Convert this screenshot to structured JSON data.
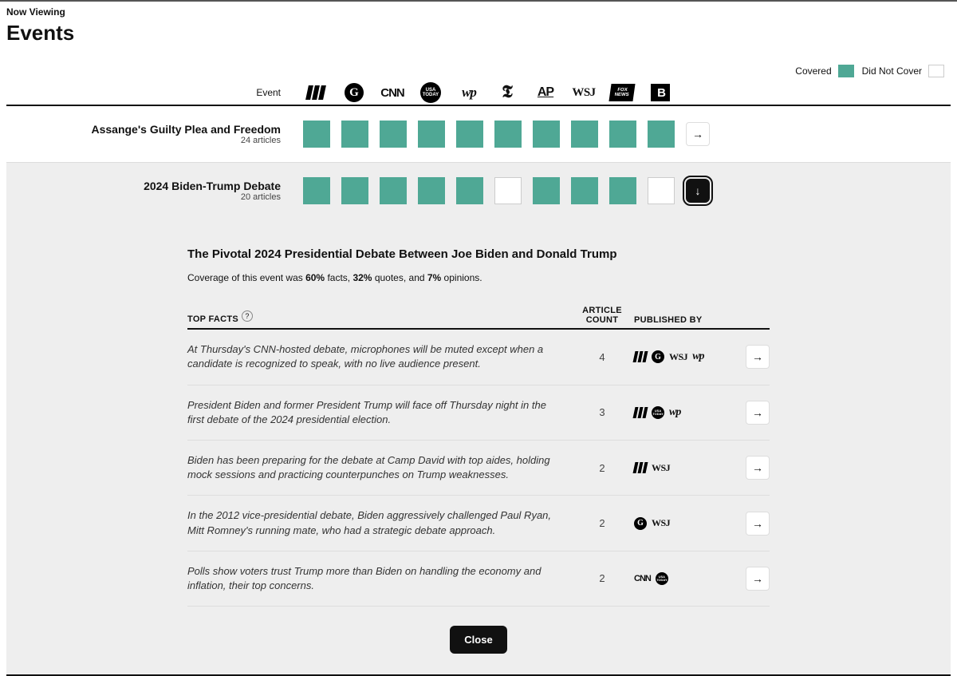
{
  "header": {
    "now_viewing": "Now Viewing",
    "title": "Events",
    "event_col": "Event"
  },
  "legend": {
    "covered": "Covered",
    "not_covered": "Did Not Cover"
  },
  "outlets": [
    "HuffPost",
    "Guardian",
    "CNN",
    "USA Today",
    "Washington Post",
    "NYT",
    "AP",
    "WSJ",
    "Fox News",
    "Breitbart"
  ],
  "rows": [
    {
      "title": "Assange's Guilty Plea and Freedom",
      "sub": "24 articles",
      "coverage": [
        1,
        1,
        1,
        1,
        1,
        1,
        1,
        1,
        1,
        1
      ],
      "button": "arrow-right"
    },
    {
      "title": "2024 Biden-Trump Debate",
      "sub": "20 articles",
      "coverage": [
        1,
        1,
        1,
        1,
        1,
        0,
        1,
        1,
        1,
        0
      ],
      "button": "arrow-down-dark"
    }
  ],
  "detail": {
    "heading": "The Pivotal 2024 Presidential Debate Between Joe Biden and Donald Trump",
    "summary": {
      "prefix": "Coverage of this event was ",
      "p1": "60%",
      "t1": " facts, ",
      "p2": "32%",
      "t2": " quotes, and ",
      "p3": "7%",
      "t3": " opinions."
    },
    "columns": {
      "c1": "Top Facts",
      "c2a": "Article",
      "c2b": "Count",
      "c3": "Published By"
    },
    "facts": [
      {
        "text": "At Thursday's CNN-hosted debate, microphones will be muted except when a candidate is recognized to speak, with no live audience present.",
        "count": "4",
        "pubs": [
          "huff",
          "guard",
          "wsj",
          "wp"
        ]
      },
      {
        "text": "President Biden and former President Trump will face off Thursday night in the first debate of the 2024 presidential election.",
        "count": "3",
        "pubs": [
          "huff",
          "usa",
          "wp"
        ]
      },
      {
        "text": "Biden has been preparing for the debate at Camp David with top aides, holding mock sessions and practicing counterpunches on Trump weaknesses.",
        "count": "2",
        "pubs": [
          "huff",
          "wsj"
        ]
      },
      {
        "text": "In the 2012 vice-presidential debate, Biden aggressively challenged Paul Ryan, Mitt Romney's running mate, who had a strategic debate approach.",
        "count": "2",
        "pubs": [
          "guard",
          "wsj"
        ]
      },
      {
        "text": "Polls show voters trust Trump more than Biden on handling the economy and inflation, their top concerns.",
        "count": "2",
        "pubs": [
          "cnn",
          "usa"
        ]
      }
    ],
    "close": "Close"
  }
}
